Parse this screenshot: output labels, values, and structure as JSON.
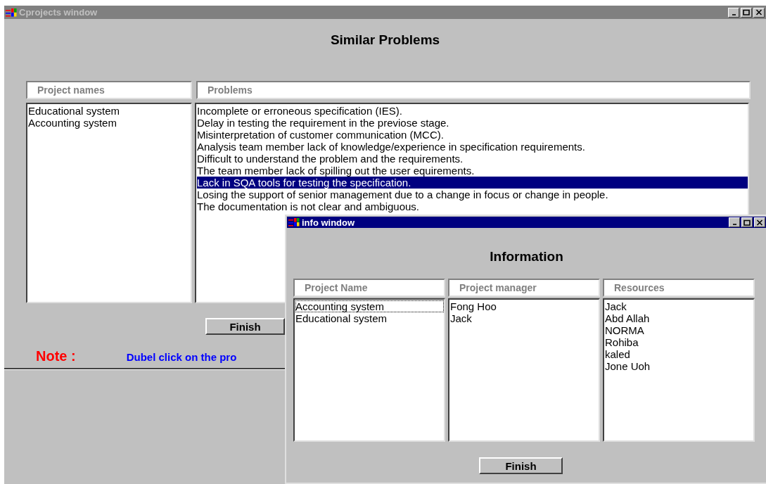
{
  "main_window": {
    "title": "Cprojects window",
    "active": false,
    "heading": "Similar Problems",
    "columns": [
      "Project names",
      "Problems"
    ],
    "projects": [
      {
        "label": "Educational system",
        "selected": false
      },
      {
        "label": "Accounting system",
        "selected": false
      }
    ],
    "problems": [
      {
        "label": "Incomplete or erroneous specification (IES).",
        "selected": false
      },
      {
        "label": "Delay in testing the requirement in the previose stage.",
        "selected": false
      },
      {
        "label": "Misinterpretation of customer communication (MCC).",
        "selected": false
      },
      {
        "label": "Analysis team member lack of knowledge/experience in specification requirements.",
        "selected": false
      },
      {
        "label": "Difficult to understand the problem and the requirements.",
        "selected": false
      },
      {
        "label": "The team member lack of spilling out the user equirements.",
        "selected": false
      },
      {
        "label": "Lack in SQA tools for testing the specification.",
        "selected": true
      },
      {
        "label": "Losing the support of senior management due to a change in focus or change in people.",
        "selected": false
      },
      {
        "label": "The documentation is not clear and ambiguous.",
        "selected": false
      }
    ],
    "finish_button": "Finish",
    "note_label": "Note :",
    "note_text": "Dubel click on the pro"
  },
  "info_window": {
    "title": "info window",
    "active": true,
    "heading": "Information",
    "columns": [
      "Project Name",
      "Project manager",
      "Resources"
    ],
    "project_names": [
      {
        "label": "Accounting system",
        "selected": false,
        "focused": true
      },
      {
        "label": "Educational system",
        "selected": false,
        "focused": false
      }
    ],
    "managers": [
      {
        "label": "Fong Hoo",
        "selected": false
      },
      {
        "label": "Jack",
        "selected": false
      }
    ],
    "resources": [
      {
        "label": "Jack",
        "selected": false
      },
      {
        "label": "Abd Allah",
        "selected": false
      },
      {
        "label": "NORMA",
        "selected": false
      },
      {
        "label": "Rohiba",
        "selected": false
      },
      {
        "label": "kaled",
        "selected": false
      },
      {
        "label": "Jone Uoh",
        "selected": false
      }
    ],
    "finish_button": "Finish"
  }
}
